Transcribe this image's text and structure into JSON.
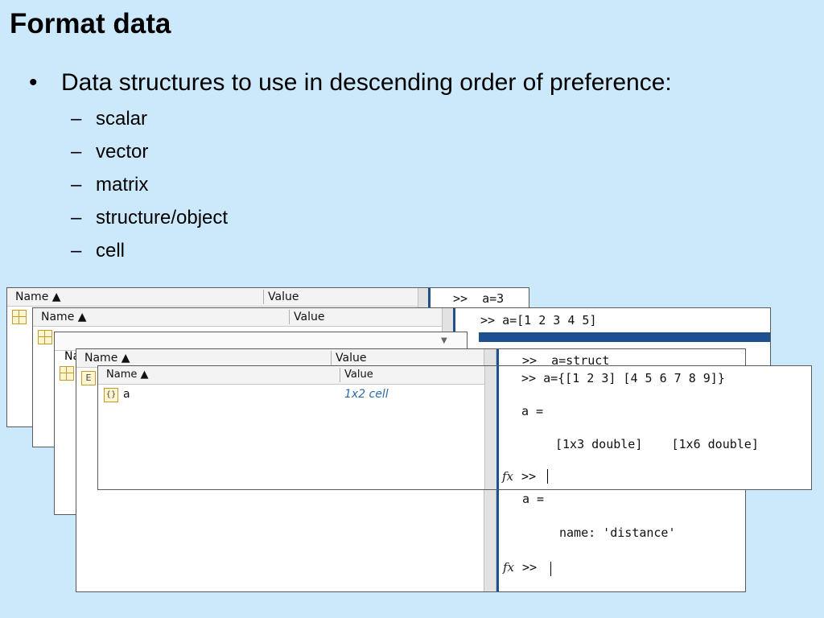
{
  "slide": {
    "title": "Format data",
    "bullet_marker": "•",
    "bullet_text": "Data structures to use in descending order of preference:",
    "dash": "–",
    "sub_items": [
      "scalar",
      "vector",
      "matrix",
      "structure/object",
      "cell"
    ]
  },
  "workspace": {
    "col_name": "Name ▲",
    "col_value": "Value",
    "sort_arrow": "▼",
    "variable_name": "a",
    "variable_value": "1x2 cell",
    "cell_icon_glyph": "{}",
    "struct_icon_glyph": "E"
  },
  "command_windows": {
    "scalar_cmd": ">>  a=3",
    "vector_cmd": ">> a=[1 2 3 4 5]",
    "struct_cmd": ">>  a=struct",
    "struct_out_a": "a =",
    "struct_out_field": "name: 'distance'",
    "cell_cmd": ">> a={[1 2 3] [4 5 6 7 8 9]}",
    "cell_out_a": "a =",
    "cell_out_value": "[1x3 double]    [1x6 double]",
    "prompt": ">>",
    "fx_label": "fx"
  },
  "colors": {
    "background": "#cce8fb",
    "accent_blue": "#1e4f8e",
    "cell_value": "#2a6aa8"
  },
  "icons": [
    "grid-icon",
    "cell-icon",
    "struct-icon",
    "fx-icon",
    "sort-arrow-icon"
  ]
}
